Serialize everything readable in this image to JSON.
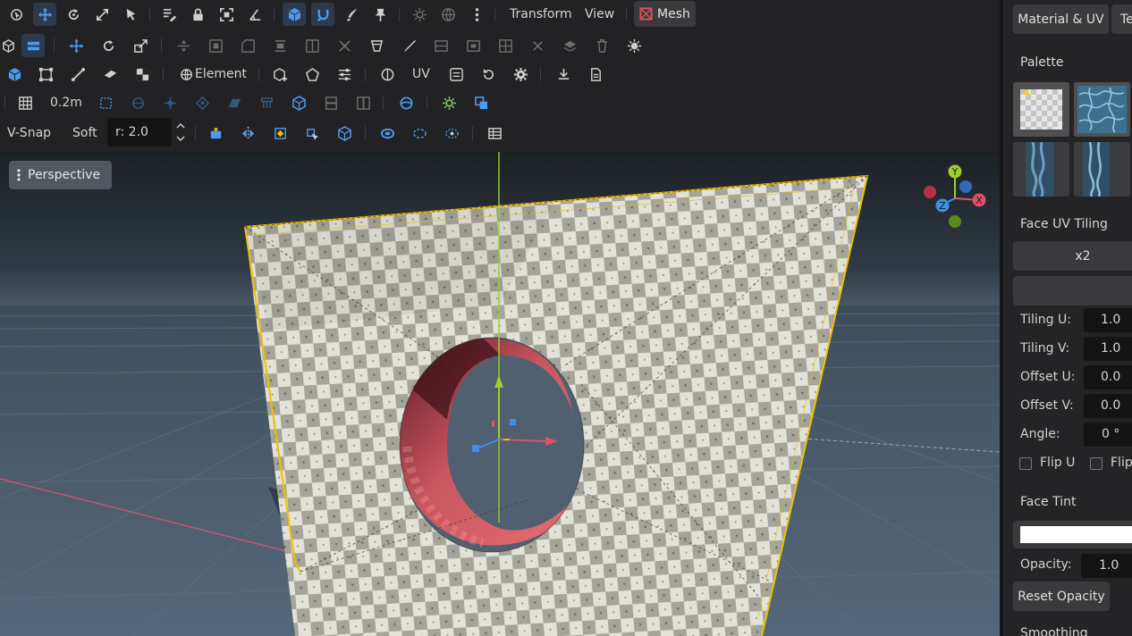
{
  "toolbar": {
    "menus": {
      "transform": "Transform",
      "view": "View",
      "mesh": "Mesh"
    },
    "element_label": "Element",
    "uv_label": "UV",
    "grid_size": "0.2m",
    "vsnap_label": "V-Snap",
    "soft_label": "Soft",
    "radius_value": "r: 2.0"
  },
  "viewport": {
    "camera_label": "Perspective",
    "gizmo": {
      "y": "Y",
      "x": "X",
      "z": "Z"
    }
  },
  "panel": {
    "tabs": {
      "material_uv": "Material & UV",
      "second_tab": "Te"
    },
    "palette_title": "Palette",
    "swatches": [
      "checker-texture",
      "water-texture",
      "blue-streak-texture",
      "blue-streak-texture-2"
    ],
    "face_uv_tiling_title": "Face UV Tiling",
    "tiling_button": "x2",
    "fields": {
      "tiling_u": {
        "label": "Tiling U:",
        "value": "1.0"
      },
      "tiling_v": {
        "label": "Tiling V:",
        "value": "1.0"
      },
      "offset_u": {
        "label": "Offset U:",
        "value": "0.0"
      },
      "offset_v": {
        "label": "Offset V:",
        "value": "0.0"
      },
      "angle": {
        "label": "Angle:",
        "value": "0 °"
      }
    },
    "flip_u": "Flip U",
    "flip_v": "Flip",
    "face_tint_title": "Face Tint",
    "tint_color": "#ffffff",
    "opacity": {
      "label": "Opacity:",
      "value": "1.0"
    },
    "reset_opacity": "Reset Opacity",
    "next_section": "Smoothing Tuning"
  },
  "colors": {
    "accent_blue": "#4d9bf0",
    "mesh_red": "#e05060",
    "selection_yellow": "#f0c000",
    "axis_green": "#9bd12a"
  }
}
